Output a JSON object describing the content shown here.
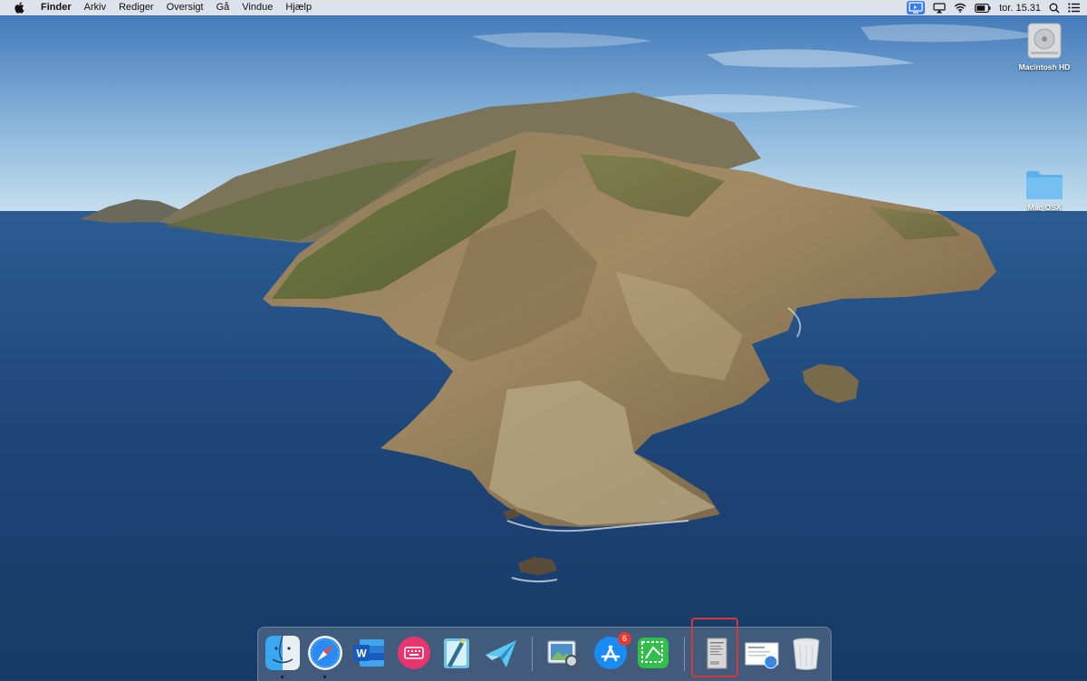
{
  "menubar": {
    "apple_icon": "apple-icon",
    "app_name": "Finder",
    "menus": [
      "Arkiv",
      "Rediger",
      "Oversigt",
      "Gå",
      "Vindue",
      "Hjælp"
    ],
    "status_icons": [
      "screen-share-icon",
      "airplay-icon",
      "wifi-icon",
      "battery-icon"
    ],
    "clock": "tor. 15.31",
    "spotlight_icon": "search-icon",
    "control_icon": "list-icon"
  },
  "desktop": {
    "icons": [
      {
        "label": "Macintosh HD",
        "icon": "hard-drive-icon"
      },
      {
        "label": "Mac OSX",
        "icon": "folder-icon"
      }
    ]
  },
  "dock": {
    "items": [
      {
        "name": "Finder",
        "icon": "finder-icon",
        "running": true
      },
      {
        "name": "Safari",
        "icon": "safari-icon",
        "running": true
      },
      {
        "name": "Microsoft Word",
        "icon": "word-icon",
        "running": false
      },
      {
        "name": "Keyboard app",
        "icon": "keyboard-icon",
        "running": false
      },
      {
        "name": "TextEdit",
        "icon": "textedit-icon",
        "running": false
      },
      {
        "name": "App",
        "icon": "paper-plane-icon",
        "running": false
      },
      {
        "name": "Preview",
        "icon": "preview-icon",
        "running": false
      },
      {
        "name": "App Store",
        "icon": "app-store-icon",
        "running": false,
        "badge": "6"
      },
      {
        "name": "App",
        "icon": "green-grid-icon",
        "running": false
      },
      {
        "name": "Document",
        "icon": "document-icon",
        "running": false,
        "highlighted": true
      },
      {
        "name": "Safari document",
        "icon": "safari-doc-icon",
        "running": false
      },
      {
        "name": "Trash",
        "icon": "trash-icon",
        "running": false
      }
    ]
  },
  "colors": {
    "sky_top": "#3d74b8",
    "sky_bottom": "#bcd8ea",
    "sea": "#1c4476",
    "highlight": "#d23a3a"
  }
}
